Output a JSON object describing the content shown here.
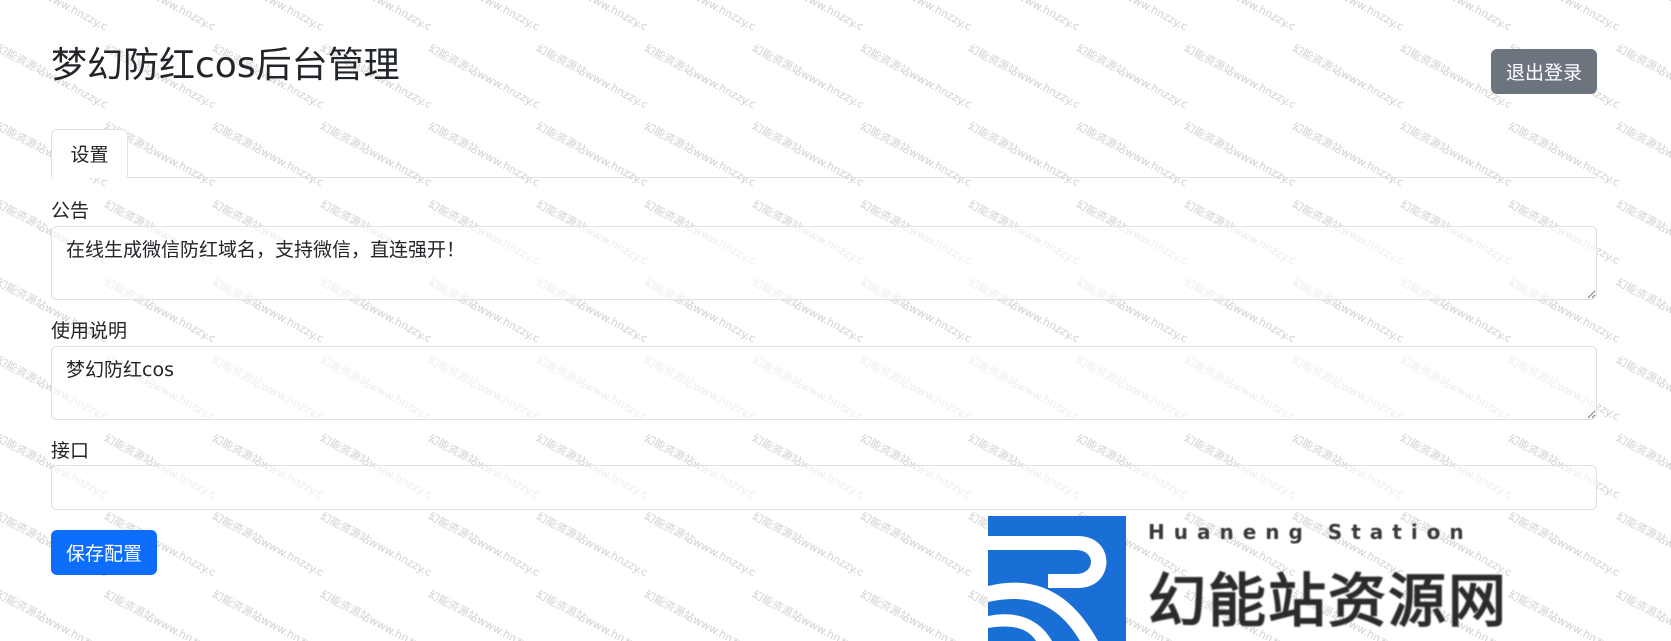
{
  "header": {
    "title": "梦幻防红cos后台管理",
    "logout_label": "退出登录"
  },
  "tabs": [
    {
      "label": "设置",
      "active": true
    }
  ],
  "form": {
    "notice": {
      "label": "公告",
      "value": "在线生成微信防红域名，支持微信，直连强开！"
    },
    "instructions": {
      "label": "使用说明",
      "value": "梦幻防红cos"
    },
    "api": {
      "label": "接口",
      "value": ""
    },
    "save_label": "保存配置"
  },
  "watermark": {
    "text": "幻能资源站www.hnzzy.c"
  },
  "brand_logo": {
    "english": "Huaneng Station",
    "chinese": "幻能站资源网"
  },
  "colors": {
    "primary": "#0d6efd",
    "secondary": "#6c757d",
    "border": "#dee2e6",
    "logo_blue": "#1a6fd6"
  }
}
